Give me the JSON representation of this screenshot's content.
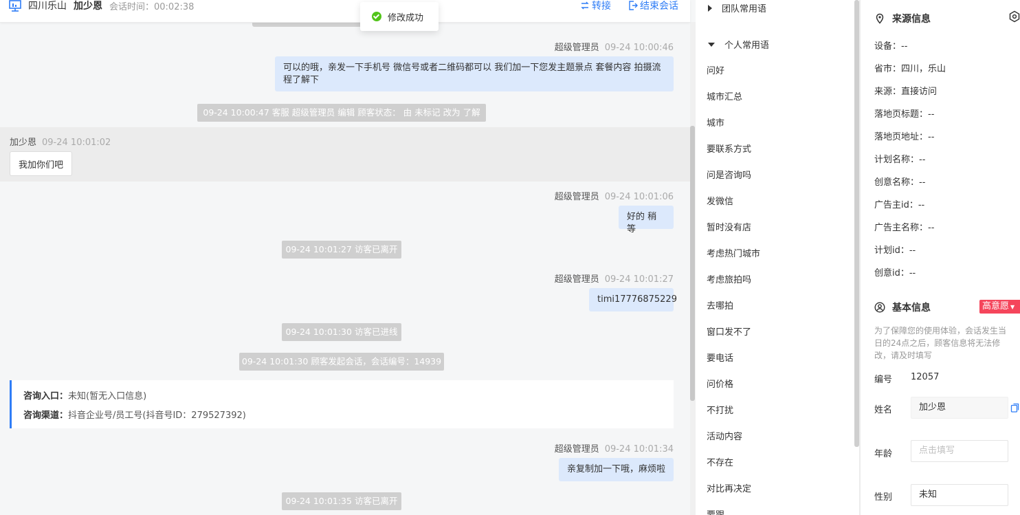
{
  "header": {
    "location": "四川乐山",
    "customer_name": "加少恩",
    "session_time": "会话时间：00:02:38",
    "transfer_label": "转接",
    "end_label": "结束会话"
  },
  "toast": {
    "text": "修改成功"
  },
  "messages": [
    {
      "sender": "超级管理员",
      "time": "09-24 10:00:46",
      "text": "可以的哦，亲发一下手机号 微信号或者二维码都可以 我们加一下您发主题景点 套餐内容 拍摄流程了解下"
    },
    {
      "sender": "超级管理员",
      "time": "09-24 10:01:06",
      "text": "好的 稍等"
    },
    {
      "sender": "超级管理员",
      "time": "09-24 10:01:27",
      "text": "timi17776875229"
    },
    {
      "sender": "超级管理员",
      "time": "09-24 10:01:34",
      "text": "亲复制加一下哦，麻烦啦"
    }
  ],
  "visitor_message": {
    "sender": "加少恩",
    "time": "09-24 10:01:02",
    "text": "我加你们吧"
  },
  "system_messages": [
    "09-24 10:00:47 客服 超级管理员 编辑 顾客状态： 由 未标记 改为 了解",
    "09-24 10:01:27 访客已离开",
    "09-24 10:01:30 访客已进线",
    "09-24 10:01:30 顾客发起会话，会话编号：14939",
    "09-24 10:01:35 访客已离开"
  ],
  "consult": {
    "entry_label": "咨询入口：",
    "entry_value": "未知(暂无入口信息)",
    "channel_label": "咨询渠道：",
    "channel_value": "抖音企业号/员工号(抖音号ID：279527392)"
  },
  "phrases": {
    "team_group": "团队常用语",
    "personal_group": "个人常用语",
    "items": [
      "问好",
      "城市汇总",
      "城市",
      "要联系方式",
      "问是咨询吗",
      "发微信",
      "暂时没有店",
      "考虑热门城市",
      "考虑旅拍吗",
      "去哪拍",
      "窗口发不了",
      "要电话",
      "问价格",
      "不打扰",
      "活动内容",
      "不存在",
      "对比再决定",
      "要跟"
    ]
  },
  "source_info": {
    "title": "来源信息",
    "rows": [
      "设备：--",
      "省市：四川，乐山",
      "来源：直接访问",
      "落地页标题：--",
      "落地页地址：--",
      "计划名称：--",
      "创意名称：--",
      "广告主id：--",
      "广告主名称：--",
      "计划id：--",
      "创意id：--"
    ]
  },
  "basic_info": {
    "title": "基本信息",
    "intent_badge": "高意愿",
    "notice": "为了保障您的使用体验，会话发生当日的24点之后，顾客信息将无法修改，请及时填写",
    "id_label": "编号",
    "id_value": "12057",
    "name_label": "姓名",
    "name_value": "加少恩",
    "age_label": "年龄",
    "age_placeholder": "点击填写",
    "gender_label": "性别",
    "gender_value": "未知"
  },
  "colors": {
    "accent": "#2f7df6",
    "bubble": "#dce9fc",
    "badge": "#f5455b",
    "success": "#52c41a"
  }
}
